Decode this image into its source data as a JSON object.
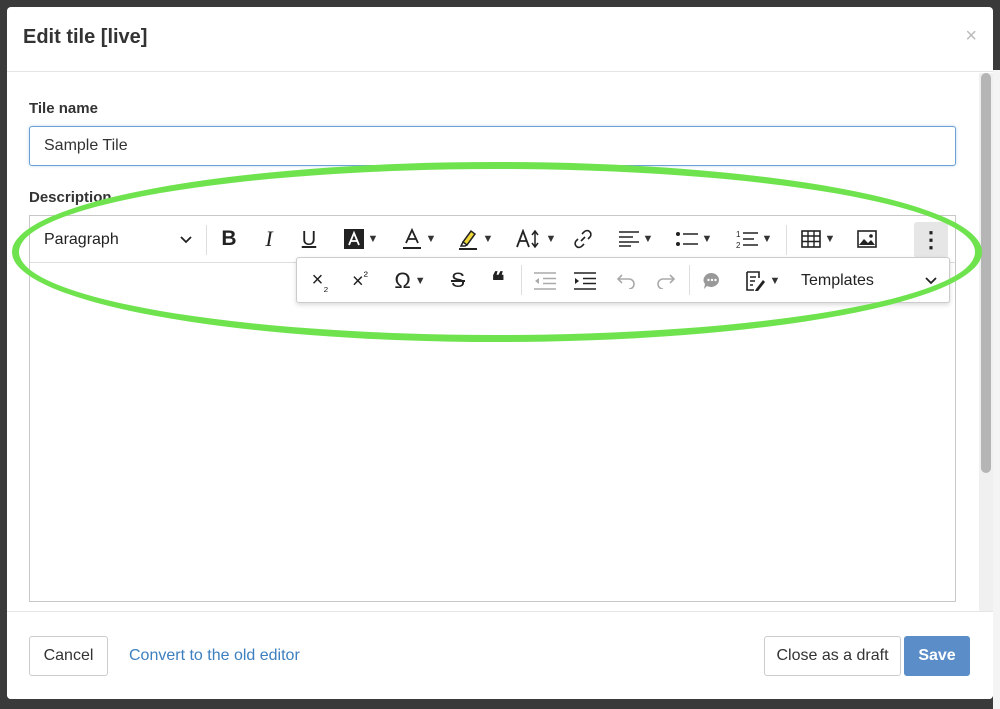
{
  "modal": {
    "title": "Edit tile [live]",
    "close_glyph": "×"
  },
  "form": {
    "tile_name_label": "Tile name",
    "tile_name_value": "Sample Tile",
    "description_label": "Description"
  },
  "toolbar": {
    "paragraph_label": "Paragraph",
    "more_glyph": "⋮",
    "templates_label": "Templates",
    "superscript_glyph": "²",
    "subscript_glyph": "₂",
    "omega_glyph": "Ω",
    "quote_glyph": "❝"
  },
  "footer": {
    "cancel_label": "Cancel",
    "convert_label": "Convert to the old editor",
    "draft_label": "Close as a draft",
    "save_label": "Save"
  },
  "colors": {
    "accent": "#5b8dc9",
    "link": "#3d7fbf",
    "highlight_ring": "#6fe34e"
  }
}
